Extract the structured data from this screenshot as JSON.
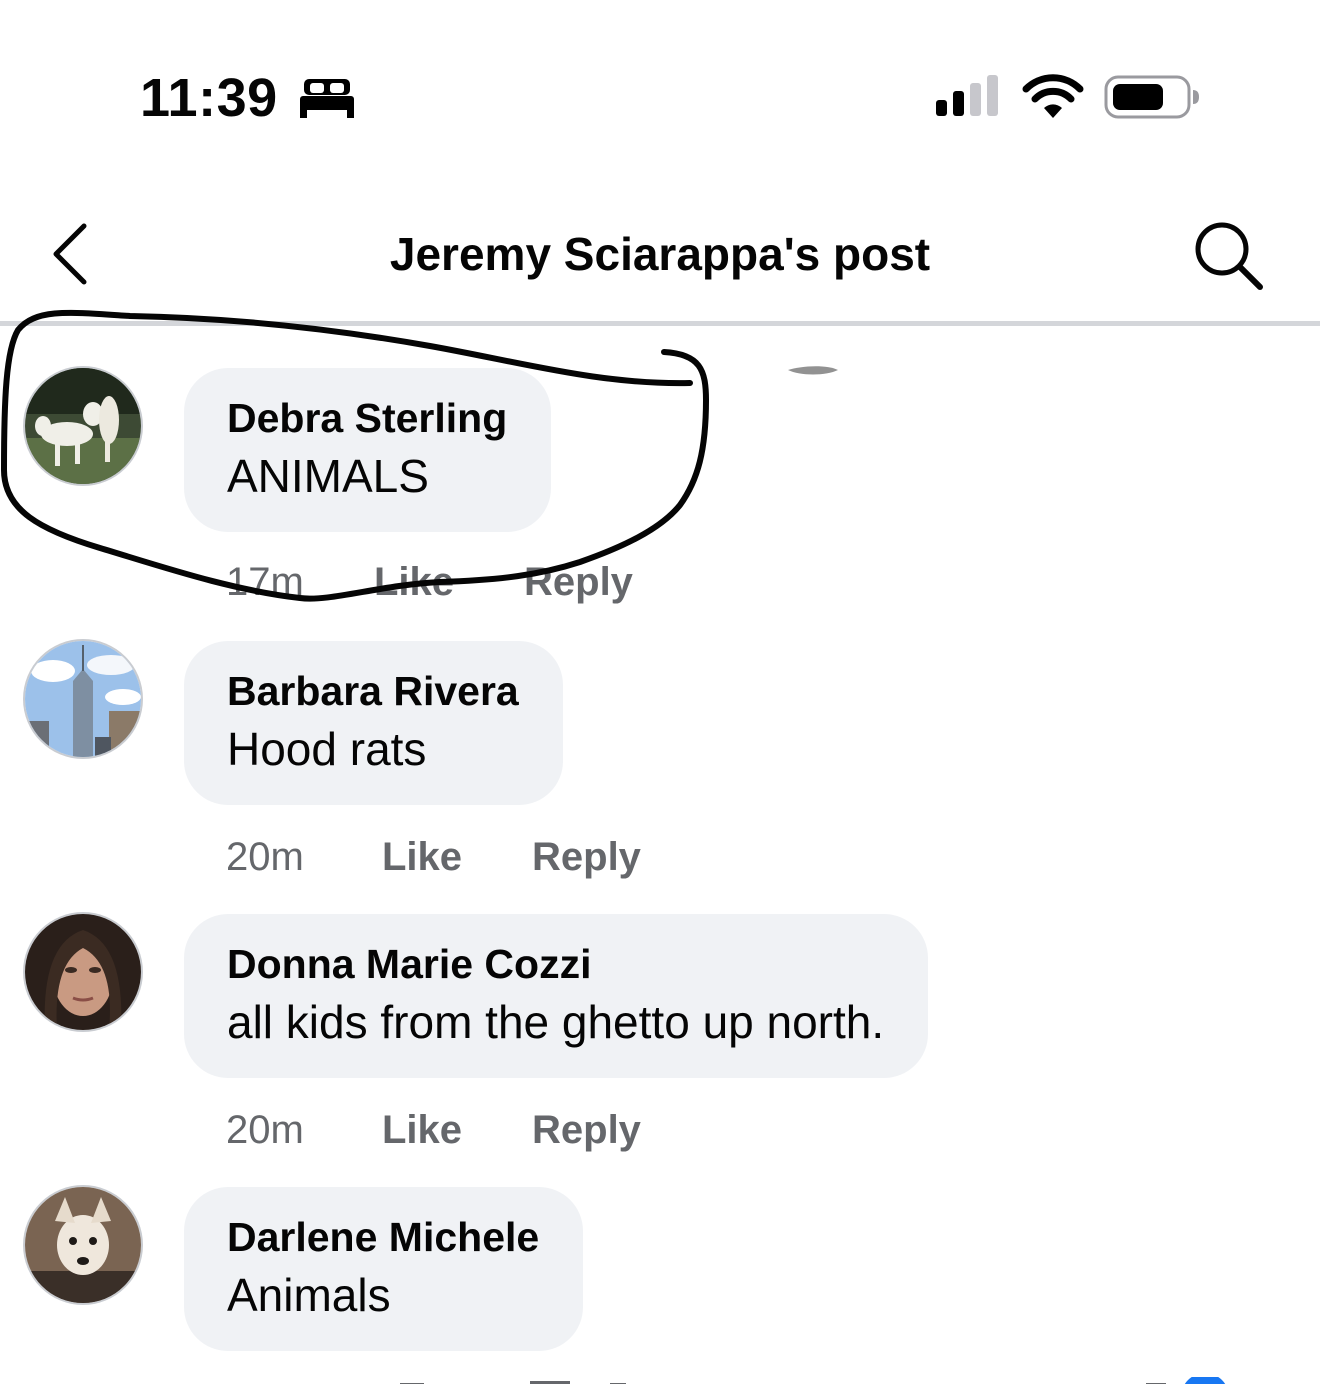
{
  "status_bar": {
    "time": "11:39",
    "icons": [
      "bed-icon",
      "cellular-signal-icon",
      "wifi-icon",
      "battery-icon"
    ]
  },
  "header": {
    "back_icon": "chevron-left-icon",
    "title": "Jeremy Sciarappa's post",
    "search_icon": "search-icon"
  },
  "comments": [
    {
      "author": "Debra Sterling",
      "text": "ANIMALS",
      "time": "17m",
      "like": "Like",
      "reply": "Reply",
      "avatar": "two white dogs on grass"
    },
    {
      "author": "Barbara Rivera",
      "text": "Hood rats",
      "time": "20m",
      "like": "Like",
      "reply": "Reply",
      "avatar": "city skyline tower"
    },
    {
      "author": "Donna Marie Cozzi",
      "text": "all kids from the ghetto up north.",
      "time": "20m",
      "like": "Like",
      "reply": "Reply",
      "avatar": "woman portrait"
    },
    {
      "author": "Darlene Michele",
      "text": "Animals",
      "avatar": "small dog"
    }
  ],
  "colors": {
    "bubble": "#f0f2f5",
    "secondary_text": "#65676b",
    "divider": "#d4d6da",
    "reaction_blue": "#1877f2"
  }
}
